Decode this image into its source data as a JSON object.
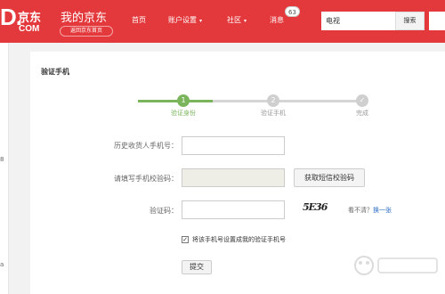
{
  "colors": {
    "brand_red": "#e4393c",
    "step_active": "#7ab55c",
    "step_inactive": "#d5d5d5"
  },
  "header": {
    "logo_d": "D.",
    "logo_jd": "京东",
    "logo_com": "COM",
    "my_jd": "我的京东",
    "back_home": "返回京东首页",
    "nav": {
      "home": "首页",
      "account": "账户设置",
      "community": "社区",
      "messages": "消息"
    },
    "message_count": "63",
    "search": {
      "value": "电视",
      "button": "搜索"
    }
  },
  "panel": {
    "title": "验证手机",
    "steps": [
      {
        "num": "1",
        "label": "验证身份",
        "active": true
      },
      {
        "num": "2",
        "label": "验证手机",
        "active": false
      },
      {
        "num": "✓",
        "label": "完成",
        "active": false
      }
    ],
    "form": {
      "history_phone_label": "历史收货人手机号：",
      "sms_code_label": "请填写手机校验码：",
      "get_sms_button": "获取短信校验码",
      "captcha_label": "验证码：",
      "captcha_text": "5E36",
      "refresh_prefix": "看不清？",
      "refresh_link": "换一张",
      "set_phone_checkbox_label": "将该手机号设置成我的验证手机号",
      "submit": "提交"
    }
  },
  "left_strip": {
    "glyph_top": "8",
    "glyph_bottom": "a"
  }
}
